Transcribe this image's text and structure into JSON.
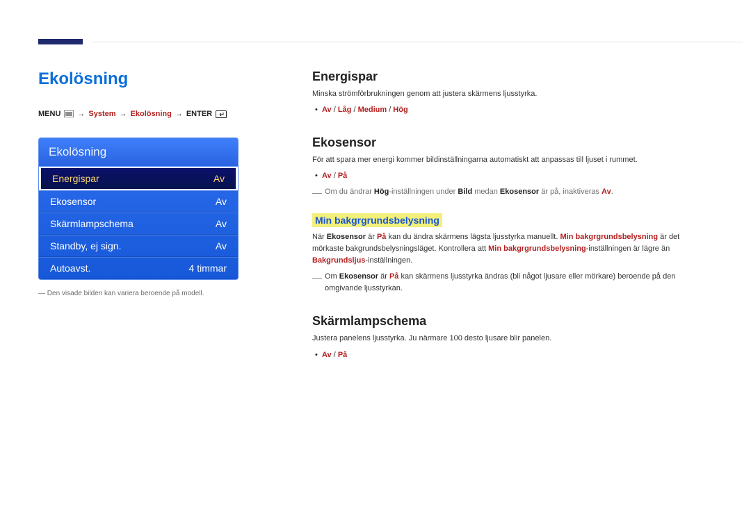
{
  "section_title": "Ekolösning",
  "breadcrumb": {
    "menu": "MENU",
    "arrow": "→",
    "system": "System",
    "ekolosning": "Ekolösning",
    "enter": "ENTER"
  },
  "osd": {
    "header": "Ekolösning",
    "rows": [
      {
        "label": "Energispar",
        "value": "Av",
        "selected": true
      },
      {
        "label": "Ekosensor",
        "value": "Av",
        "selected": false
      },
      {
        "label": "Skärmlampschema",
        "value": "Av",
        "selected": false
      },
      {
        "label": "Standby, ej sign.",
        "value": "Av",
        "selected": false
      },
      {
        "label": "Autoavst.",
        "value": "4 timmar",
        "selected": false
      }
    ]
  },
  "caption_prefix": "―",
  "caption": "Den visade bilden kan variera beroende på modell.",
  "right": {
    "energispar": {
      "title": "Energispar",
      "desc": "Minska strömförbrukningen genom att justera skärmens ljusstyrka.",
      "options": [
        "Av",
        "Låg",
        "Medium",
        "Hög"
      ]
    },
    "ekosensor": {
      "title": "Ekosensor",
      "desc": "För att spara mer energi kommer bildinställningarna automatiskt att anpassas till ljuset i rummet.",
      "options": [
        "Av",
        "På"
      ],
      "note_plain_1": "Om du ändrar ",
      "note_bold_hog": "Hög",
      "note_plain_2": "-inställningen under ",
      "note_bold_bild": "Bild",
      "note_plain_3": " medan ",
      "note_bold_eko": "Ekosensor",
      "note_plain_4": " är på, inaktiveras ",
      "note_bold_av": "Av",
      "note_plain_5": "."
    },
    "minbak": {
      "title": "Min bakgrgrundsbelysning",
      "p1_a": "När ",
      "p1_eko": "Ekosensor",
      "p1_b": " är ",
      "p1_pa": "På",
      "p1_c": " kan du ändra skärmens lägsta ljusstyrka manuellt. ",
      "p1_min": "Min bakgrgrundsbelysning",
      "p1_d": " är det mörkaste bakgrundsbelysningsläget. Kontrollera att ",
      "p1_min2": "Min bakgrgrundsbelysning",
      "p1_e": "-inställningen är lägre än ",
      "p1_bak": "Bakgrundsljus",
      "p1_f": "-inställningen.",
      "note_a": "Om ",
      "note_eko": "Ekosensor",
      "note_b": " är ",
      "note_pa": "På",
      "note_c": " kan skärmens ljusstyrka ändras (bli något ljusare eller mörkare) beroende på den omgivande ljusstyrkan."
    },
    "skarm": {
      "title": "Skärmlampschema",
      "desc": "Justera panelens ljusstyrka. Ju närmare 100 desto ljusare blir panelen.",
      "options": [
        "Av",
        "På"
      ]
    }
  }
}
